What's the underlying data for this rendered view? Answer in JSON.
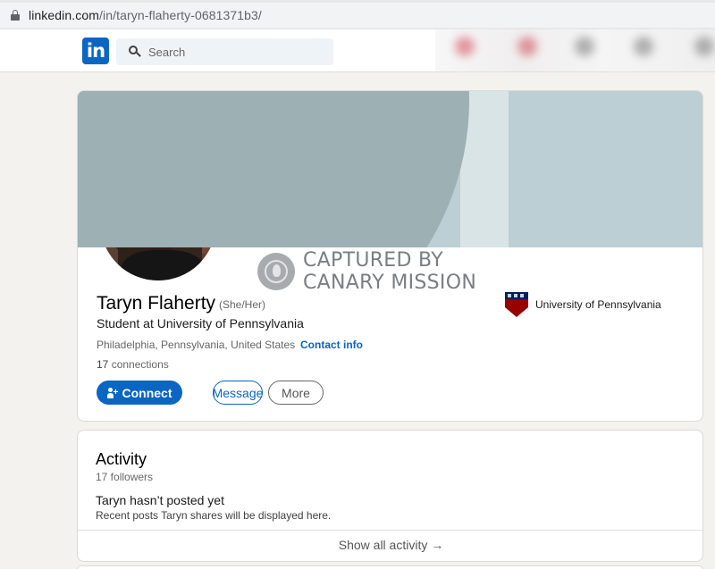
{
  "browser": {
    "url_host": "linkedin.com",
    "url_path": "/in/taryn-flaherty-0681371b3/"
  },
  "nav": {
    "logo_text": "in",
    "search_placeholder": "Search"
  },
  "profile": {
    "name": "Taryn Flaherty",
    "pronouns": "(She/Her)",
    "headline": "Student at University of Pennsylvania",
    "location": "Philadelphia, Pennsylvania, United States",
    "contact_label": "Contact info",
    "connections_count": "17",
    "connections_label": "connections",
    "education": "University of Pennsylvania",
    "buttons": {
      "connect": "Connect",
      "message": "Message",
      "more": "More"
    }
  },
  "watermark": {
    "line1": "CAPTURED BY",
    "line2": "CANARY MISSION"
  },
  "activity": {
    "title": "Activity",
    "followers": "17 followers",
    "empty_title": "Taryn hasn’t posted yet",
    "empty_desc": "Recent posts Taryn shares will be displayed here.",
    "show_all": "Show all activity →"
  },
  "colors": {
    "brand": "#0a66c2",
    "banner_dark": "#9db0b4",
    "banner_light": "#bccfd4",
    "penn_blue": "#011f5b",
    "penn_red": "#990000"
  }
}
